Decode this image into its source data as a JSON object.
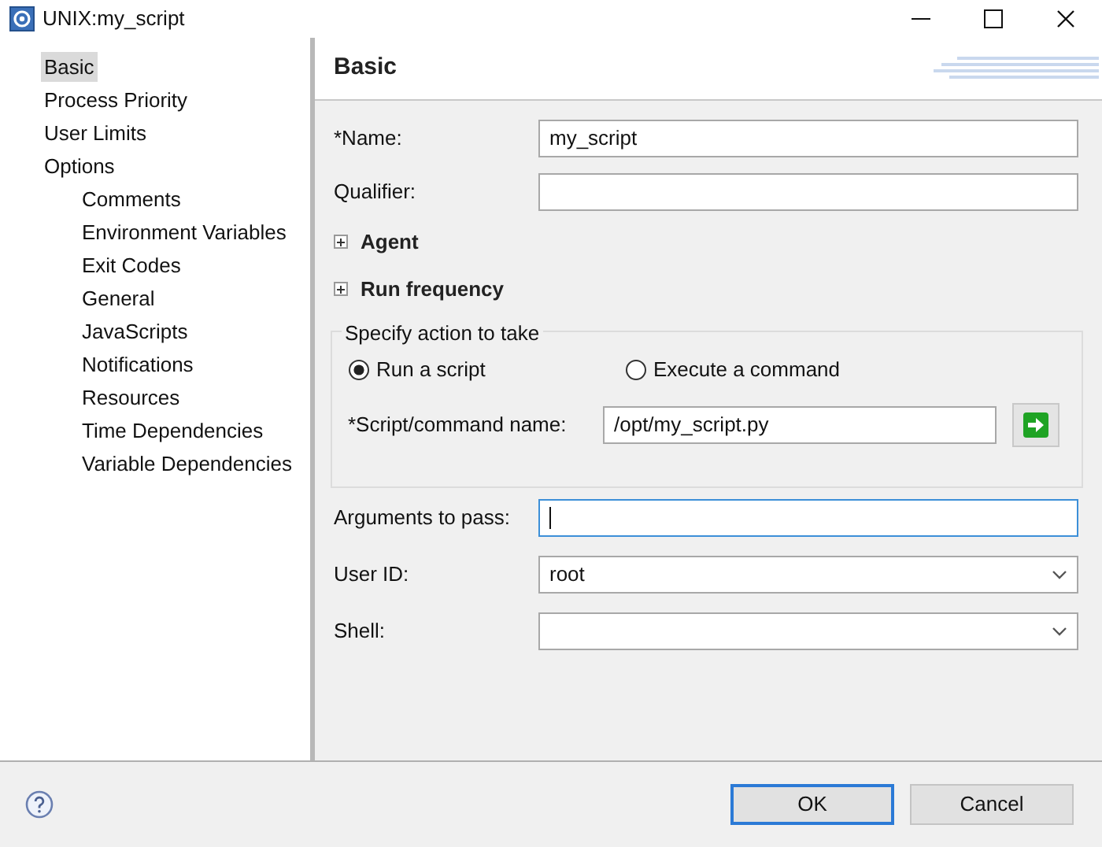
{
  "window": {
    "title": "UNIX:my_script"
  },
  "sidebar": {
    "items": [
      {
        "label": "Basic",
        "selected": true
      },
      {
        "label": "Process Priority",
        "selected": false
      },
      {
        "label": "User Limits",
        "selected": false
      },
      {
        "label": "Options",
        "selected": false,
        "children": [
          {
            "label": "Comments",
            "selected": false
          },
          {
            "label": "Environment Variables",
            "selected": false
          },
          {
            "label": "Exit Codes",
            "selected": false
          },
          {
            "label": "General",
            "selected": false
          },
          {
            "label": "JavaScripts",
            "selected": false
          },
          {
            "label": "Notifications",
            "selected": false
          },
          {
            "label": "Resources",
            "selected": false
          },
          {
            "label": "Time Dependencies",
            "selected": false
          },
          {
            "label": "Variable Dependencies",
            "selected": false
          }
        ]
      }
    ]
  },
  "page": {
    "title": "Basic",
    "top_fields": [
      {
        "label": "*Name:",
        "value": "my_script",
        "focused": false
      },
      {
        "label": "Qualifier:",
        "focused": false
      }
    ],
    "sections": [
      {
        "label": "Agent",
        "expanded": false
      },
      {
        "label": "Run frequency",
        "expanded": false
      }
    ],
    "action_group": {
      "title": "Specify action to take",
      "options": [
        {
          "label": "Run a script",
          "selected": true
        },
        {
          "label": "Execute a command",
          "selected": false
        }
      ],
      "field": {
        "label": "*Script/command name:",
        "value": "/opt/my_script.py"
      }
    },
    "bottom_fields": [
      {
        "label": "Arguments to pass:",
        "dropdown": false,
        "focused": true
      },
      {
        "label": "User ID:",
        "value": "root",
        "dropdown": true,
        "focused": false
      },
      {
        "label": "Shell:",
        "dropdown": true,
        "focused": false
      }
    ]
  },
  "buttons": [
    {
      "label": "OK",
      "default": true
    },
    {
      "label": "Cancel",
      "default": false
    }
  ]
}
